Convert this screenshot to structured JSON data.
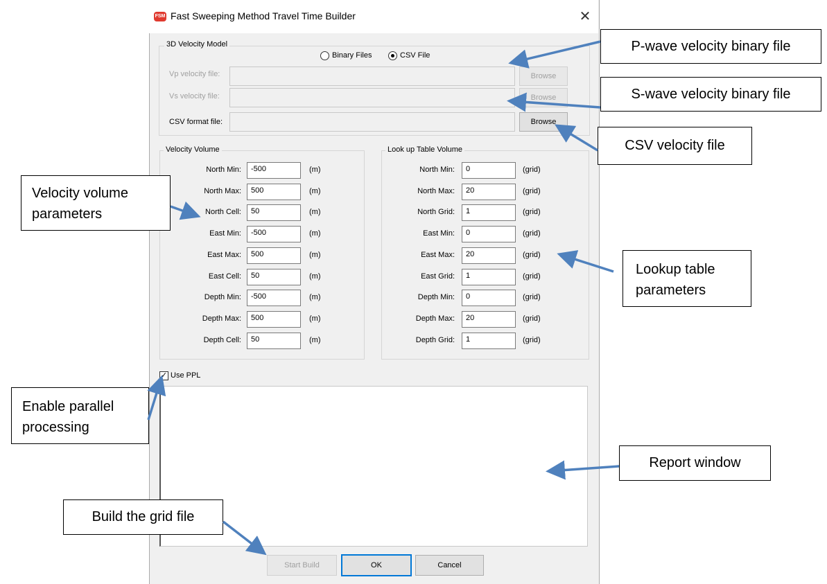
{
  "window": {
    "title": "Fast Sweeping Method Travel Time Builder",
    "close_glyph": "✕",
    "icon_text": "FSM"
  },
  "model": {
    "group_label": "3D Velocity Model",
    "radio_binary": "Binary Files",
    "radio_csv": "CSV File",
    "selected": "CSV File",
    "vp_label": "Vp velocity file:",
    "vs_label": "Vs velocity file:",
    "csv_label": "CSV format file:",
    "vp_value": "",
    "vs_value": "",
    "csv_value": "",
    "browse_label": "Browse"
  },
  "velocity": {
    "group_label": "Velocity Volume",
    "rows": [
      {
        "label": "North Min:",
        "value": "-500",
        "unit": "(m)"
      },
      {
        "label": "North Max:",
        "value": "500",
        "unit": "(m)"
      },
      {
        "label": "North Cell:",
        "value": "50",
        "unit": "(m)"
      },
      {
        "label": "East Min:",
        "value": "-500",
        "unit": "(m)"
      },
      {
        "label": "East Max:",
        "value": "500",
        "unit": "(m)"
      },
      {
        "label": "East Cell:",
        "value": "50",
        "unit": "(m)"
      },
      {
        "label": "Depth Min:",
        "value": "-500",
        "unit": "(m)"
      },
      {
        "label": "Depth Max:",
        "value": "500",
        "unit": "(m)"
      },
      {
        "label": "Depth Cell:",
        "value": "50",
        "unit": "(m)"
      }
    ]
  },
  "lookup": {
    "group_label": "Look up Table Volume",
    "rows": [
      {
        "label": "North Min:",
        "value": "0",
        "unit": "(grid)"
      },
      {
        "label": "North Max:",
        "value": "20",
        "unit": "(grid)"
      },
      {
        "label": "North Grid:",
        "value": "1",
        "unit": "(grid)"
      },
      {
        "label": "East Min:",
        "value": "0",
        "unit": "(grid)"
      },
      {
        "label": "East Max:",
        "value": "20",
        "unit": "(grid)"
      },
      {
        "label": "East Grid:",
        "value": "1",
        "unit": "(grid)"
      },
      {
        "label": "Depth Min:",
        "value": "0",
        "unit": "(grid)"
      },
      {
        "label": "Depth Max:",
        "value": "20",
        "unit": "(grid)"
      },
      {
        "label": "Depth Grid:",
        "value": "1",
        "unit": "(grid)"
      }
    ]
  },
  "options": {
    "use_ppl_label": "Use PPL",
    "use_ppl_checked": true,
    "check_glyph": "✓"
  },
  "report": {
    "text": ""
  },
  "buttons": {
    "start_build": "Start Build",
    "ok": "OK",
    "cancel": "Cancel"
  },
  "callouts": {
    "p_wave": "P-wave velocity binary file",
    "s_wave": "S-wave velocity binary file",
    "csv": "CSV velocity file",
    "velocity_params": "Velocity volume parameters",
    "lookup_params": "Lookup table parameters",
    "parallel": "Enable parallel processing",
    "report": "Report window",
    "build": "Build the grid file"
  },
  "colors": {
    "arrow": "#4f81bd",
    "app_icon": "#e03a2f",
    "dialog_bg": "#f0f0f0"
  }
}
